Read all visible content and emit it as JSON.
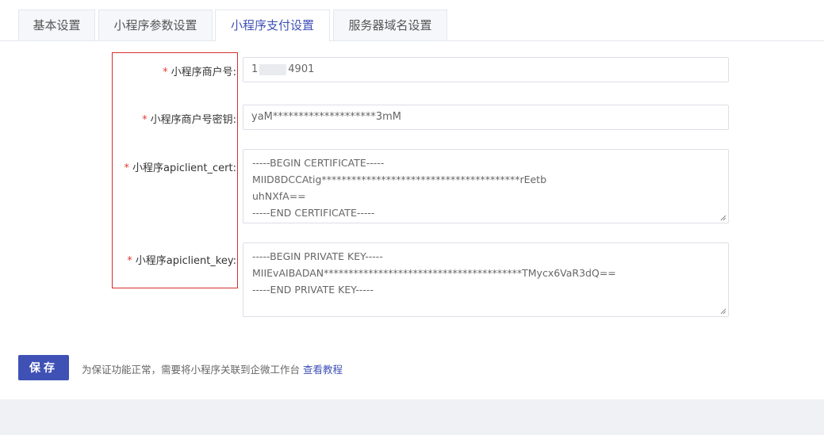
{
  "tabs": [
    {
      "label": "基本设置",
      "active": false
    },
    {
      "label": "小程序参数设置",
      "active": false
    },
    {
      "label": "小程序支付设置",
      "active": true
    },
    {
      "label": "服务器域名设置",
      "active": false
    }
  ],
  "form": {
    "required_mark": "*",
    "merchant_id": {
      "label": "小程序商户号:",
      "value_prefix": "1",
      "value_suffix": "4901"
    },
    "merchant_key": {
      "label": "小程序商户号密钥:",
      "value": "yaM********************3mM"
    },
    "apiclient_cert": {
      "label": "小程序apiclient_cert:",
      "lines": [
        "-----BEGIN CERTIFICATE-----",
        "MIID8DCCAtig****************************************rEetb",
        "uhNXfA==",
        "-----END CERTIFICATE-----"
      ]
    },
    "apiclient_key": {
      "label": "小程序apiclient_key:",
      "lines": [
        "-----BEGIN PRIVATE KEY-----",
        "MIIEvAIBADAN****************************************TMycx6VaR3dQ==",
        "-----END PRIVATE KEY-----"
      ]
    }
  },
  "actions": {
    "save_label": "保存",
    "hint_text": "为保证功能正常，需要将小程序关联到企微工作台",
    "hint_link": "查看教程"
  },
  "colors": {
    "accent": "#3f51b5",
    "required": "#e53935",
    "highlight_box": "#d32f2f"
  }
}
